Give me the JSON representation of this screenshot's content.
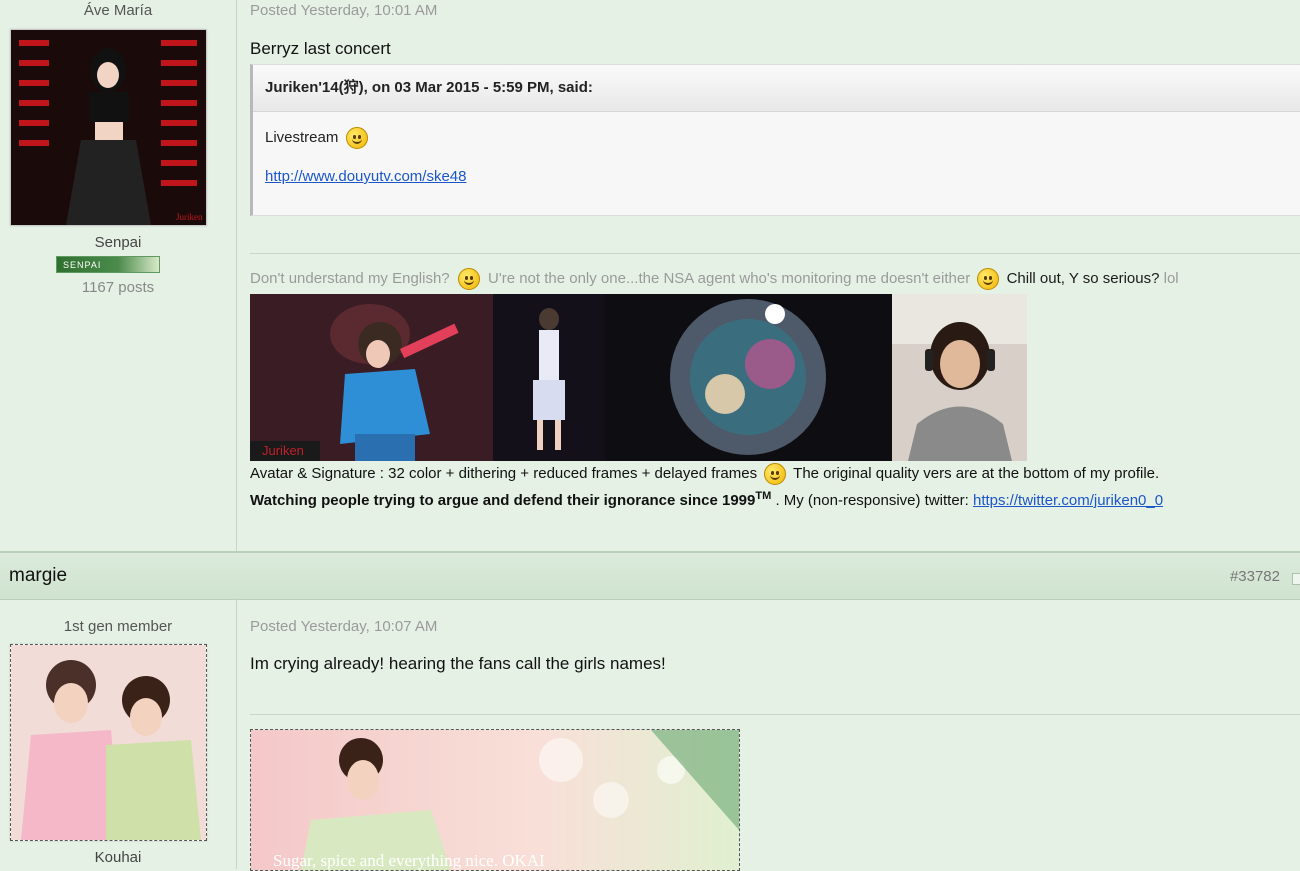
{
  "post1": {
    "group_title": "Áve María",
    "rank": "Senpai",
    "badge_label": "SENPAI",
    "post_count": "1167 posts",
    "posted": "Posted Yesterday, 10:01 AM",
    "text": "Berryz last concert",
    "quote": {
      "header": "Juriken'14(狩), on 03 Mar 2015 - 5:59 PM, said:",
      "body": "Livestream",
      "link": "http://www.douyutv.com/ske48"
    },
    "signature": {
      "line1_part1": "Don't understand my English?",
      "line1_part2": "U're not the only one...the NSA agent who's monitoring me doesn't either",
      "line1_part3": "Chill out, Y so serious?",
      "line1_part4": "lol",
      "image_caption": "Juriken",
      "line2_part1": "Avatar & Signature : 32 color + dithering + reduced frames + delayed frames",
      "line2_part2": "The original quality vers are at the bottom of my profile.",
      "line3_bold": "Watching people trying to argue and defend their ignorance since 1999",
      "line3_sup": "TM",
      "line3_text": ". My (non-responsive) twitter:",
      "line3_link": "https://twitter.com/juriken0_0"
    }
  },
  "post2": {
    "author": "margie",
    "post_number": "#33782",
    "group_title": "1st gen member",
    "rank": "Kouhai",
    "posted": "Posted Yesterday, 10:07 AM",
    "text": "Im crying already! hearing the fans call the girls names!",
    "signature_caption": "Sugar, spice and everything nice. OKAI"
  },
  "colors": {
    "background": "#e6f1e6",
    "header_bar": "#d3e6d3",
    "link": "#1b57c9"
  }
}
